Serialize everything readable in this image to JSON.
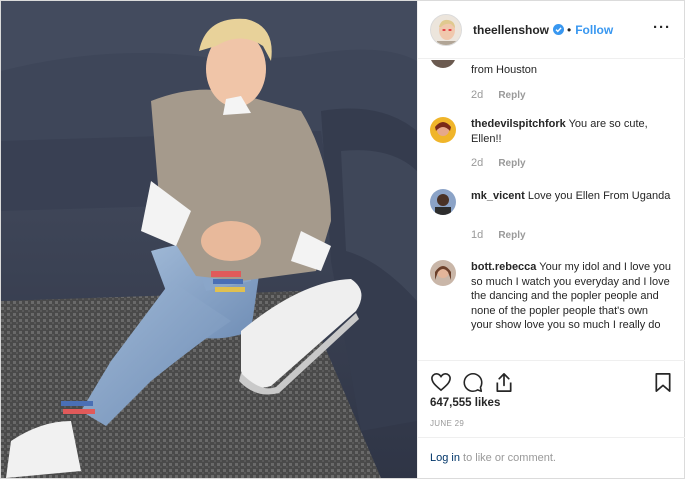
{
  "post": {
    "username": "theellenshow",
    "follow_label": "Follow",
    "separator": "•",
    "more_icon": "more-options-icon",
    "verified_icon": "verified-badge-icon"
  },
  "comments": [
    {
      "username": "",
      "text": "from Houston",
      "age": "2d",
      "reply": "Reply"
    },
    {
      "username": "thedevilspitchfork",
      "text": "You are so cute, Ellen!!",
      "age": "2d",
      "reply": "Reply"
    },
    {
      "username": "mk_vicent",
      "text": "Love you Ellen From Uganda",
      "age": "1d",
      "reply": "Reply"
    },
    {
      "username": "bott.rebecca",
      "text": "Your my idol and I love you so much I watch you everyday and I love the dancing and the popler people and none of the popler people that's own your show love you so much I really do",
      "age": "",
      "reply": ""
    }
  ],
  "actions": {
    "likes": "647,555 likes",
    "date": "JUNE 29",
    "login_link": "Log in",
    "login_rest": " to like or comment.",
    "icons": [
      "heart-icon",
      "comment-icon",
      "share-icon",
      "bookmark-icon"
    ]
  },
  "colors": {
    "link_blue": "#3897f0",
    "meta_gray": "#999999",
    "text": "#262626",
    "border": "#efefef"
  }
}
